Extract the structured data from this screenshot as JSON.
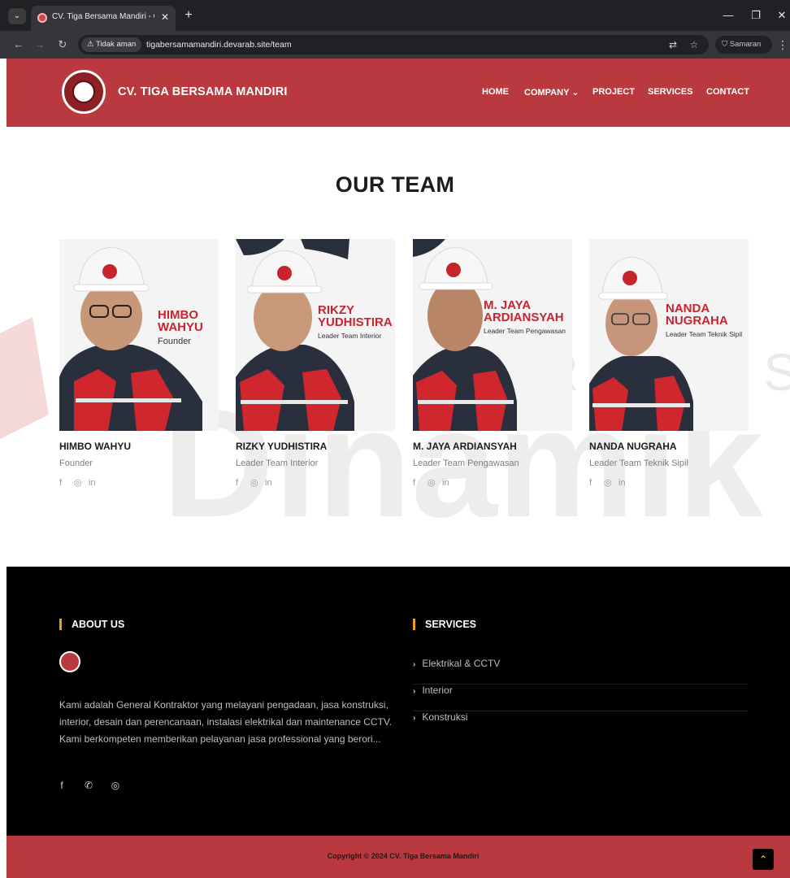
{
  "browser": {
    "tab_title": "CV. Tiga Bersama Mandiri - Our",
    "tab_close": "✕",
    "new_tab": "+",
    "security_label": "⚠ Tidak aman",
    "url": "tigabersamamandiri.devarab.site/team",
    "profile_label": "Samaran",
    "window": {
      "minimize": "—",
      "restore": "❐",
      "close": "✕"
    },
    "icons": {
      "back": "←",
      "forward": "→",
      "reload": "↻",
      "translate": "⇄",
      "star": "☆",
      "incognito": "⛉",
      "menu": "⋮",
      "tab_list": "⌄"
    }
  },
  "header": {
    "brand": "CV. TIGA BERSAMA MANDIRI",
    "nav": [
      "HOME",
      "COMPANY ⌄",
      "PROJECT",
      "SERVICES",
      "CONTACT"
    ]
  },
  "main": {
    "title": "OUR TEAM",
    "watermark": "UNIVERSITAS Dinamika",
    "team": [
      {
        "name": "HIMBO WAHYU",
        "role": "Founder",
        "photo_name_line1": "HIMBO",
        "photo_name_line2": "WAHYU",
        "photo_role": "Founder"
      },
      {
        "name": "RIZKY YUDHISTIRA",
        "role": "Leader Team Interior",
        "photo_name_line1": "RIKZY",
        "photo_name_line2": "YUDHISTIRA",
        "photo_role": "Leader Team Interior"
      },
      {
        "name": "M. JAYA ARDIANSYAH",
        "role": "Leader Team Pengawasan",
        "photo_name_line1": "M. JAYA",
        "photo_name_line2": "ARDIANSYAH",
        "photo_role": "Leader Team Pengawasan"
      },
      {
        "name": "NANDA NUGRAHA",
        "role": "Leader Team Teknik Sipil",
        "photo_name_line1": "NANDA",
        "photo_name_line2": "NUGRAHA",
        "photo_role": "Leader Team Teknik Sipil"
      }
    ],
    "social_icons": {
      "facebook": "f",
      "instagram": "◎",
      "linkedin": "in"
    }
  },
  "footer": {
    "about_heading": "ABOUT US",
    "about_text": "Kami adalah General Kontraktor yang melayani pengadaan, jasa konstruksi, interior, desain dan perencanaan, instalasi elektrikal dan maintenance CCTV. Kami berkompeten memberikan pelayanan jasa professional yang berori...",
    "social_icons": {
      "facebook": "f",
      "whatsapp": "✆",
      "instagram": "◎"
    },
    "services_heading": "SERVICES",
    "services": [
      "Elektrikal & CCTV",
      "Interior",
      "Konstruksi"
    ],
    "copyright": "Copyright © 2024 CV. Tiga Bersama Mandiri",
    "back_to_top": "⌃"
  },
  "colors": {
    "brand_red": "#b9393e",
    "accent_yellow": "#f0a01a",
    "footer_black": "#000000"
  }
}
